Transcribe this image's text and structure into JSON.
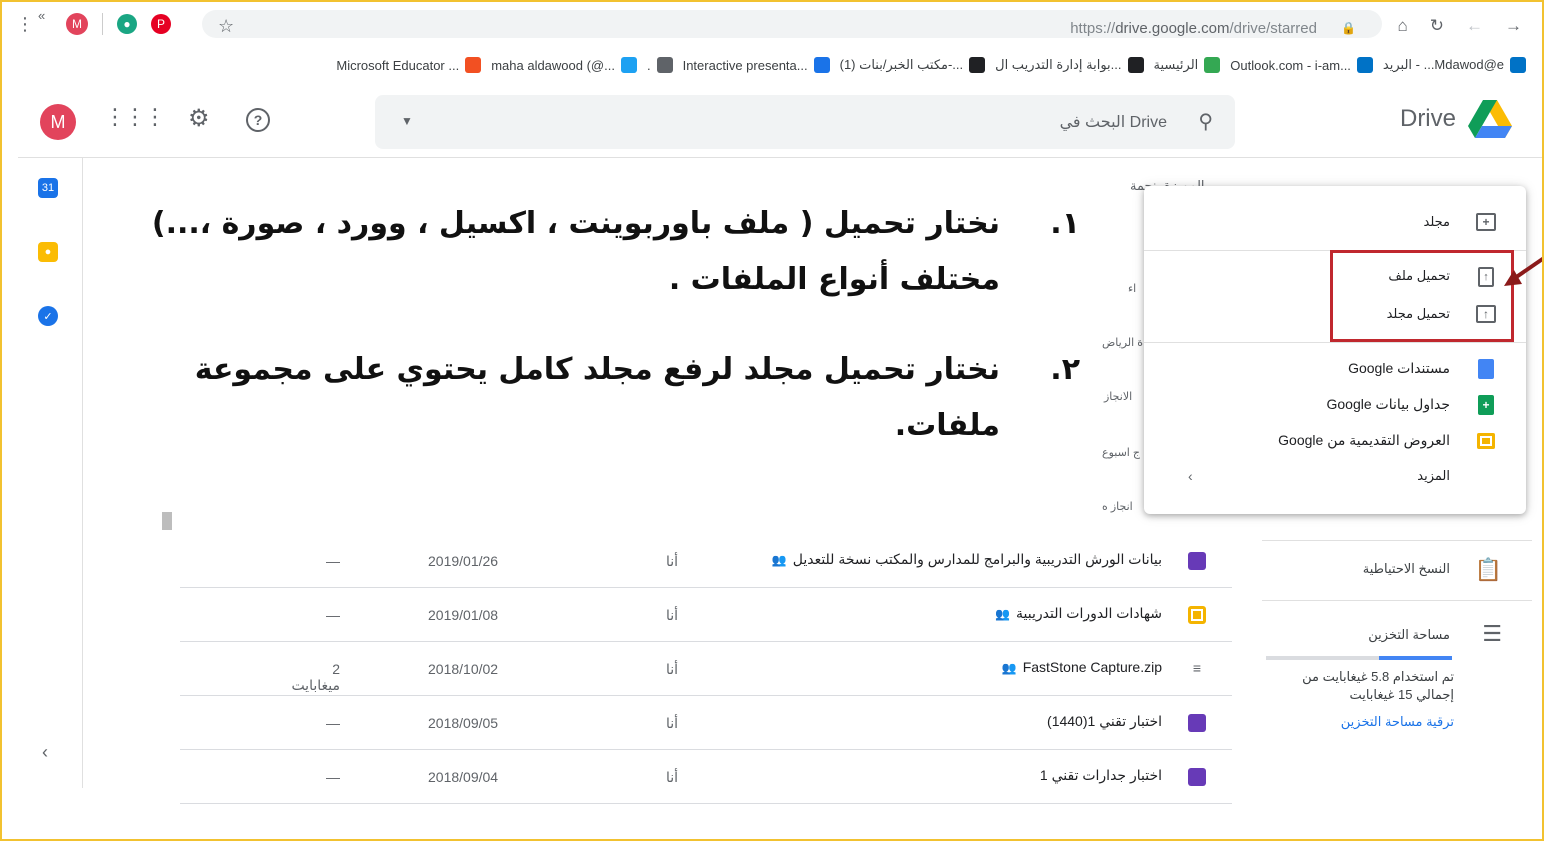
{
  "browser": {
    "url_prefix": "https://",
    "url_host": "drive.google.com",
    "url_path": "/drive/starred",
    "profile_initial": "M",
    "more_label": "«"
  },
  "bookmarks": [
    {
      "label": "Microsoft Educator ...",
      "color": "#f25022"
    },
    {
      "label": "maha aldawood (@...",
      "color": "#1da1f2"
    },
    {
      "label": ".",
      "color": "#5f6368"
    },
    {
      "label": "Interactive presenta...",
      "color": "#1a73e8"
    },
    {
      "label": "(1) مكتب الخبر/بنات-...",
      "color": "#202124"
    },
    {
      "label": "بوابة إدارة التدريب ال...",
      "color": "#202124"
    },
    {
      "label": "الرئيسية",
      "color": "#34a853"
    },
    {
      "label": "Outlook.com - i-am...",
      "color": "#0072c6"
    },
    {
      "label": "البريد - ...Mdawod@e",
      "color": "#0072c6"
    }
  ],
  "header": {
    "logo_text": "Drive",
    "search_placeholder": "البحث في Drive",
    "avatar_initial": "M"
  },
  "menu": {
    "items": [
      {
        "label": "مجلد"
      },
      {
        "label": "تحميل ملف"
      },
      {
        "label": "تحميل مجلد"
      },
      {
        "label": "مستندات Google"
      },
      {
        "label": "جداول بيانات Google"
      },
      {
        "label": "العروض التقديمية من Google"
      },
      {
        "label": "المزيد"
      }
    ]
  },
  "instructions": [
    {
      "num": "١.",
      "text": "نختار تحميل ( ملف باوربوينت ، اكسيل ، وورد ، صورة ،...) مختلف أنواع الملفات ."
    },
    {
      "num": "٢.",
      "text": "نختار تحميل مجلد لرفع مجلد كامل يحتوي على مجموعة ملفات."
    }
  ],
  "files": [
    {
      "name": "بيانات الورش التدريبية والبرامج للمدارس والمكتب نسخة للتعديل",
      "owner": "أنا",
      "date": "2019/01/26",
      "size": "—",
      "type": "form",
      "shared": true
    },
    {
      "name": "شهادات الدورات التدريبية",
      "owner": "أنا",
      "date": "2019/01/08",
      "size": "—",
      "type": "slides",
      "shared": true
    },
    {
      "name": "FastStone Capture.zip",
      "owner": "أنا",
      "date": "2018/10/02",
      "size": "2 ميغابايت",
      "type": "zip",
      "shared": true
    },
    {
      "name": "اختبار تقني 1(1440)",
      "owner": "أنا",
      "date": "2018/09/05",
      "size": "—",
      "type": "form",
      "shared": false
    },
    {
      "name": "اختبار جدارات تقني 1",
      "owner": "أنا",
      "date": "2018/09/04",
      "size": "—",
      "type": "form",
      "shared": false
    }
  ],
  "right_nav": {
    "backups_label": "النسخ الاحتياطية",
    "storage_label": "مساحة التخزين",
    "storage_used_fraction": 0.39,
    "storage_text": "تم استخدام 5.8 غيغابايت من إجمالي 15 غيغابايت",
    "upgrade_label": "ترقية مساحة التخزين"
  },
  "background_fragments": {
    "starred_title": "المميزة بنجمة",
    "frag1": "اء",
    "frag2": "ة الرياض",
    "frag3": "الانجاز",
    "frag4": "ج اسبوع",
    "frag5": "انجاز ه"
  },
  "colors": {
    "accent": "#1a73e8",
    "highlight_box": "#c0282e",
    "frame": "#f2c230"
  }
}
